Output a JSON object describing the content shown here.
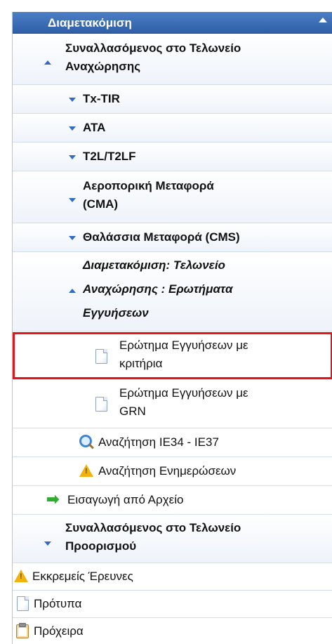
{
  "header": {
    "title": "Διαμετακόμιση"
  },
  "items": [
    {
      "label_line1": "Συναλλασόμενος στο Τελωνείο",
      "label_line2": "Αναχώρησης"
    },
    {
      "label": "Tx-TIR"
    },
    {
      "label": "ATA"
    },
    {
      "label": "T2L/T2LF"
    },
    {
      "label_line1": "Αεροπορική Μεταφορά",
      "label_line2": "(CMA)"
    },
    {
      "label": "Θαλάσσια Μεταφορά (CMS)"
    },
    {
      "label_line1": "Διαμετακόμιση: Τελωνείο",
      "label_line2": "Αναχώρησης : Ερωτήματα",
      "label_line3": "Εγγυήσεων"
    },
    {
      "label_line1": "Ερώτημα Εγγυήσεων με",
      "label_line2": "κριτήρια"
    },
    {
      "label_line1": "Ερώτημα Εγγυήσεων με",
      "label_line2": "GRN"
    },
    {
      "label": "Αναζήτηση IE34 - IE37"
    },
    {
      "label": "Αναζήτηση Ενημερώσεων"
    },
    {
      "label": "Εισαγωγή από Αρχείο"
    },
    {
      "label_line1": "Συναλλασόμενος στο Τελωνείο",
      "label_line2": "Προορισμού"
    },
    {
      "label": "Εκκρεμείς Έρευνες"
    },
    {
      "label": "Πρότυπα"
    },
    {
      "label": "Πρόχειρα"
    }
  ]
}
